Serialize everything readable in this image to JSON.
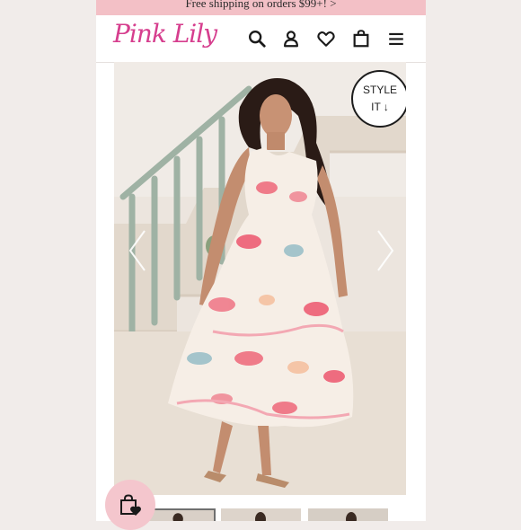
{
  "promo": {
    "text": "Free shipping on orders $99+! >"
  },
  "header": {
    "logo_text": "Pink Lily",
    "icons": [
      "search-icon",
      "account-icon",
      "heart-icon",
      "shopping-bag-icon",
      "menu-icon"
    ]
  },
  "hero": {
    "style_it_line1": "STYLE",
    "style_it_line2": "IT ↓"
  },
  "thumbnails": {
    "count": 3,
    "active_index": 0
  },
  "floating_button": {
    "icon": "shopping-bag-heart-icon"
  },
  "colors": {
    "promo_bg": "#f3c0c6",
    "brand_pink": "#d63e8e",
    "bag_button_bg": "#f4c6cd",
    "outer_bg": "#f1ecea"
  }
}
